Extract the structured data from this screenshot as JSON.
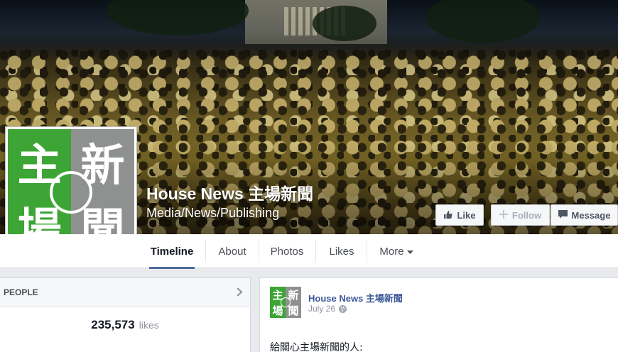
{
  "page": {
    "name": "House News 主場新聞",
    "category": "Media/News/Publishing",
    "logo_chars": [
      "主",
      "新",
      "場",
      "聞"
    ]
  },
  "actions": {
    "like": "Like",
    "follow": "Follow",
    "message": "Message"
  },
  "tabs": [
    {
      "label": "Timeline",
      "active": true
    },
    {
      "label": "About"
    },
    {
      "label": "Photos"
    },
    {
      "label": "Likes"
    },
    {
      "label": "More"
    }
  ],
  "people": {
    "title": "PEOPLE",
    "likes_count": "235,573",
    "likes_word": "likes"
  },
  "post": {
    "author": "House News 主場新聞",
    "date": "July 26",
    "text": "給關心主場新聞的人:"
  },
  "colors": {
    "logo_green": "#3da535",
    "logo_gray": "#8f9190",
    "link_blue": "#3b5998",
    "tab_underline": "#4d6a9c"
  }
}
